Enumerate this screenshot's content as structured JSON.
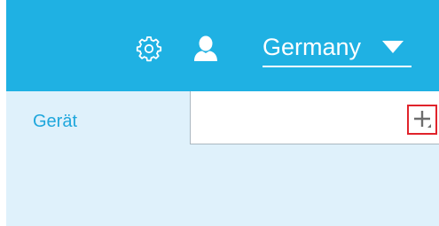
{
  "colors": {
    "header_bg": "#1fb1e3",
    "subbar_bg": "#dff1fb",
    "tab_text": "#1fa7dc",
    "highlight_border": "#e0232b"
  },
  "header": {
    "settings_icon": "gear-icon",
    "user_icon": "user-icon",
    "country": {
      "selected": "Germany",
      "dropdown_icon": "caret-down-icon"
    }
  },
  "subheader": {
    "tab_label": "Gerät",
    "add_icon": "plus-icon"
  }
}
